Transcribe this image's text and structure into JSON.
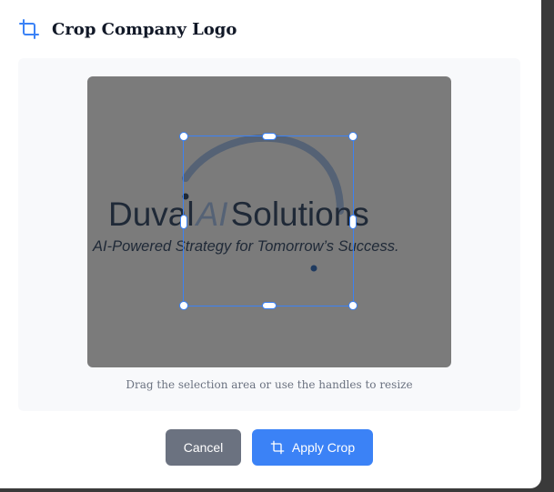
{
  "dialog": {
    "title": "Crop Company Logo",
    "title_icon": "crop-icon"
  },
  "crop": {
    "hint": "Drag the selection area or use the handles to resize",
    "logo": {
      "brand_part1": "Duval",
      "brand_part2": "AI",
      "brand_part3": "Solutions",
      "tagline": "AI-Powered Strategy for Tomorrow’s Success."
    }
  },
  "actions": {
    "cancel_label": "Cancel",
    "apply_label": "Apply Crop",
    "apply_icon": "crop-icon"
  },
  "colors": {
    "accent": "#3b82f6",
    "cancel": "#6b7280",
    "canvas": "#7b7b7b",
    "logo_text": "#1f2937",
    "logo_accent": "#556275"
  }
}
